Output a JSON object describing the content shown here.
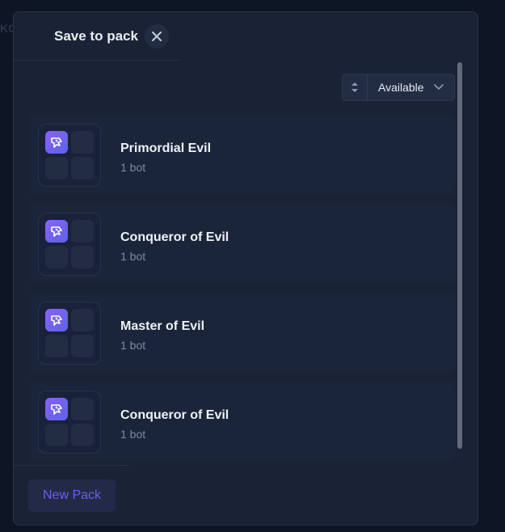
{
  "modal": {
    "title": "Save to pack",
    "close_icon": "close-icon",
    "filter": {
      "sort_icon": "sort-updown-icon",
      "selected": "Available",
      "chevron_icon": "chevron-down-icon"
    },
    "packs": [
      {
        "name": "Primordial Evil",
        "count": "1 bot",
        "thumb_icon": "bot-logo-icon"
      },
      {
        "name": "Conqueror of Evil",
        "count": "1 bot",
        "thumb_icon": "bot-logo-icon"
      },
      {
        "name": "Master of Evil",
        "count": "1 bot",
        "thumb_icon": "bot-logo-icon"
      },
      {
        "name": "Conqueror of Evil",
        "count": "1 bot",
        "thumb_icon": "bot-logo-icon"
      }
    ],
    "new_pack_label": "New Pack"
  },
  "colors": {
    "accent": "#6f5bf0",
    "modal_bg": "#1a2335",
    "page_bg": "#0e1524"
  }
}
